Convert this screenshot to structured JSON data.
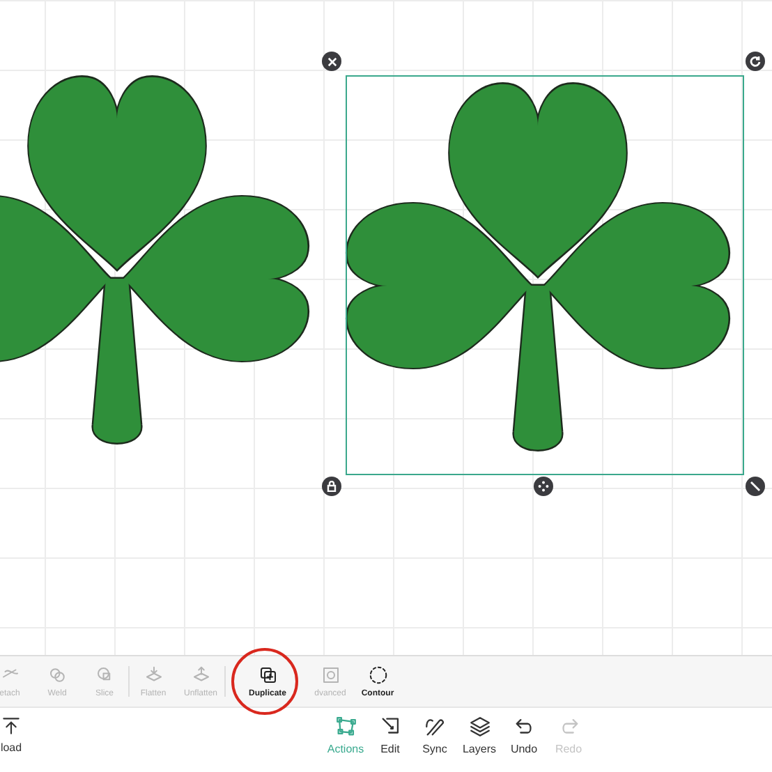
{
  "canvas": {
    "shapes": [
      {
        "kind": "shamrock"
      },
      {
        "kind": "shamrock",
        "selected": true
      }
    ]
  },
  "actions": [
    {
      "label": "etach",
      "kind": "detach",
      "disabled": true
    },
    {
      "label": "Weld",
      "kind": "weld",
      "disabled": true
    },
    {
      "label": "Slice",
      "kind": "slice",
      "disabled": true
    },
    {
      "label": "Flatten",
      "kind": "flatten",
      "disabled": true
    },
    {
      "label": "Unflatten",
      "kind": "unflatten",
      "disabled": true
    },
    {
      "label": "Duplicate",
      "kind": "duplicate",
      "disabled": false
    },
    {
      "label": "dvanced",
      "kind": "advanced",
      "disabled": true
    },
    {
      "label": "Contour",
      "kind": "contour",
      "disabled": false
    }
  ],
  "nav_left": {
    "label": "load",
    "kind": "upload"
  },
  "nav": [
    {
      "label": "Actions",
      "kind": "actions",
      "selected": true,
      "disabled": false
    },
    {
      "label": "Edit",
      "kind": "edit",
      "selected": false,
      "disabled": false
    },
    {
      "label": "Sync",
      "kind": "sync",
      "selected": false,
      "disabled": false
    },
    {
      "label": "Layers",
      "kind": "layers",
      "selected": false,
      "disabled": false
    },
    {
      "label": "Undo",
      "kind": "undo",
      "selected": false,
      "disabled": false
    },
    {
      "label": "Redo",
      "kind": "redo",
      "selected": false,
      "disabled": true
    }
  ]
}
